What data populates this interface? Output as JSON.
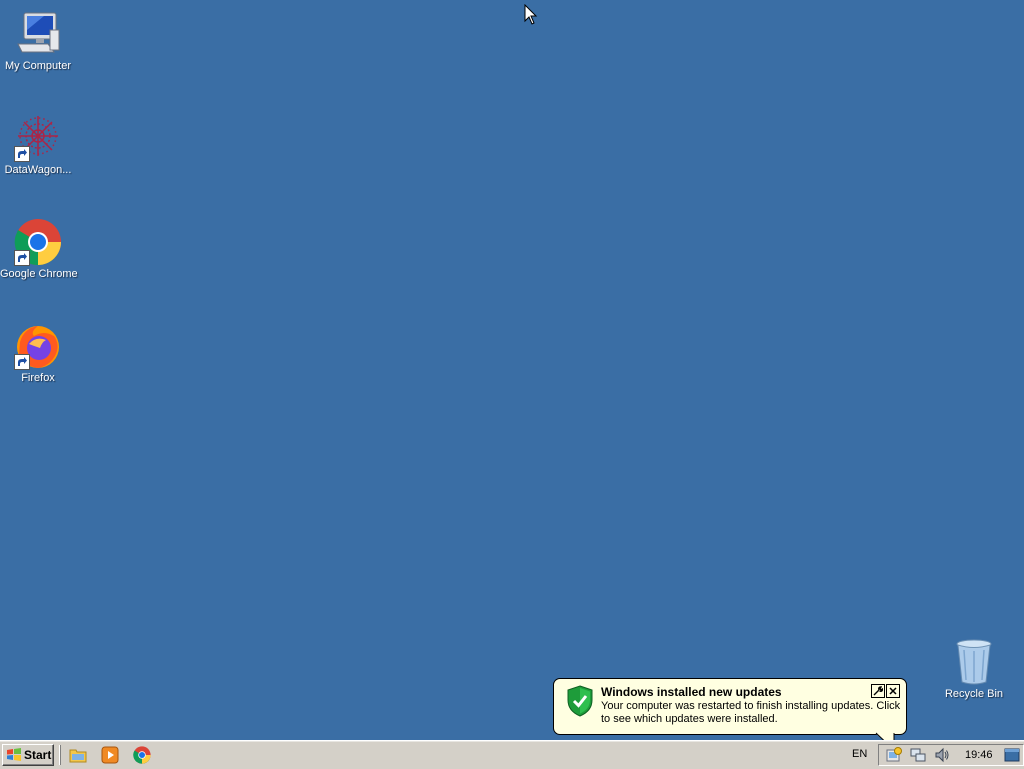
{
  "desktop": {
    "background": "#3a6ea5",
    "icons": [
      {
        "label": "My Computer",
        "icon": "my-computer-icon"
      },
      {
        "label": "DataWagon...",
        "icon": "datawagon-icon"
      },
      {
        "label": "Google Chrome",
        "icon": "chrome-icon"
      },
      {
        "label": "Firefox",
        "icon": "firefox-icon"
      },
      {
        "label": "Recycle Bin",
        "icon": "recycle-bin-icon"
      }
    ]
  },
  "taskbar": {
    "start_label": "Start",
    "quick_launch": [
      "file-explorer-icon",
      "media-player-icon",
      "chrome-icon"
    ],
    "language": "EN",
    "tray_icons": [
      "windows-update-icon",
      "network-icon",
      "volume-icon",
      "show-desktop-icon"
    ],
    "clock": "19:46"
  },
  "balloon": {
    "title": "Windows installed new updates",
    "body": "Your computer was restarted to finish installing updates. Click to see which updates were installed.",
    "icon": "shield-check-icon"
  }
}
